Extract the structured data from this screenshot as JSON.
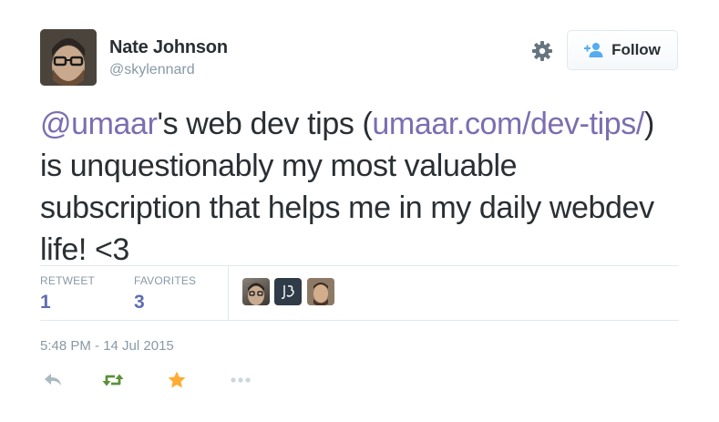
{
  "user": {
    "name": "Nate Johnson",
    "handle": "@skylennard"
  },
  "follow_button": {
    "label": "Follow",
    "icon": "add-user-icon"
  },
  "tweet": {
    "segments": [
      {
        "text": "@umaar",
        "link": true
      },
      {
        "text": "'s web dev tips (",
        "link": false
      },
      {
        "text": "umaar.com/dev-tips/",
        "link": true
      },
      {
        "text": ") is unquestionably my most valuable subscription that helps me in my daily webdev life! <3",
        "link": false
      }
    ]
  },
  "stats": {
    "retweets_label": "RETWEET",
    "retweets_value": "1",
    "favorites_label": "FAVORITES",
    "favorites_value": "3"
  },
  "timestamp": "5:48 PM - 14 Jul 2015",
  "actions": {
    "reply": "reply-icon",
    "retweet": "retweet-icon",
    "favorite": "star-icon",
    "more": "more-icon"
  },
  "colors": {
    "link": "#7c6eb0",
    "retweet": "#5c913b",
    "favorite": "#ffac33",
    "muted": "#8899a6"
  }
}
